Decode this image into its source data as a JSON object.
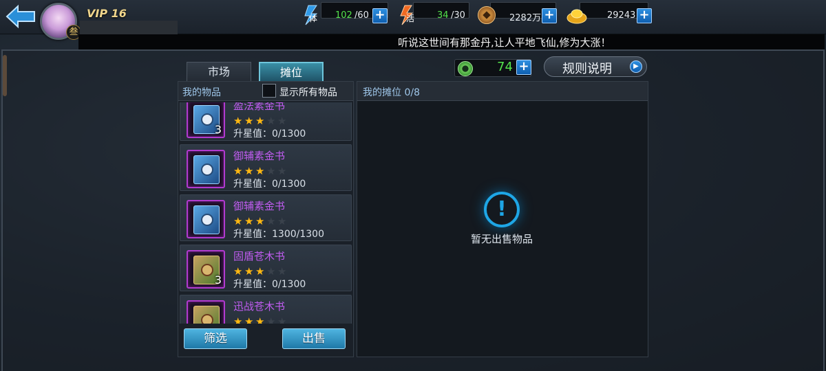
{
  "header": {
    "vip": "VIP 16",
    "avatar_badge": "叁",
    "stamina_icon_text": "体",
    "stamina": "102",
    "stamina_max": "/60",
    "energy_icon_text": "活",
    "energy": "34",
    "energy_max": "/30",
    "coins": "2282万",
    "gold": "29243",
    "marquee": "听说这世间有那金丹,让人平地飞仙,修为大涨！"
  },
  "tabs": [
    {
      "label": "市场",
      "active": false
    },
    {
      "label": "摊位",
      "active": true
    }
  ],
  "inventory": {
    "title": "我的物品",
    "show_all_label": "显示所有物品",
    "items": [
      {
        "name": "盈法素金书",
        "stars": 3,
        "max_stars": 5,
        "value": "升星值：0/1300",
        "count": "3",
        "type": "blue"
      },
      {
        "name": "御辅素金书",
        "stars": 3,
        "max_stars": 5,
        "value": "升星值：0/1300",
        "count": "",
        "type": "blue"
      },
      {
        "name": "御辅素金书",
        "stars": 3,
        "max_stars": 5,
        "value": "升星值：1300/1300",
        "count": "",
        "type": "blue"
      },
      {
        "name": "固盾苍木书",
        "stars": 3,
        "max_stars": 5,
        "value": "升星值：0/1300",
        "count": "3",
        "type": "green"
      },
      {
        "name": "迅战苍木书",
        "stars": 3,
        "max_stars": 5,
        "value": "",
        "count": "",
        "type": "green"
      }
    ],
    "filter_label": "筛选",
    "sell_label": "出售"
  },
  "stall": {
    "title": "我的摊位 0/8",
    "empty_text": "暂无出售物品"
  },
  "jade": "74",
  "rules_label": "规则说明",
  "colors": {
    "accent": "#1ea6e6",
    "item_name": "#c05cf0",
    "jade_green": "#54e34c",
    "star": "#ffb812"
  }
}
